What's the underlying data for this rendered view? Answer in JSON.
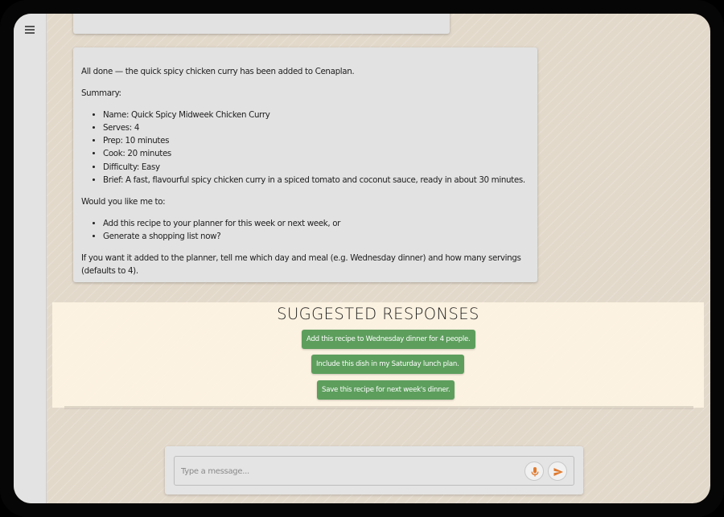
{
  "sidebar": {
    "menu_icon": "hamburger-menu-icon"
  },
  "chat": {
    "message": {
      "intro": "All done — the quick spicy chicken curry has been added to Cenaplan.",
      "summary_label": "Summary:",
      "summary_items": [
        "Name: Quick Spicy Midweek Chicken Curry",
        "Serves: 4",
        "Prep: 10 minutes",
        "Cook: 20 minutes",
        "Difficulty: Easy",
        "Brief: A fast, flavourful spicy chicken curry in a spiced tomato and coconut sauce, ready in about 30 minutes."
      ],
      "question": "Would you like me to:",
      "options": [
        "Add this recipe to your planner for this week or next week, or",
        "Generate a shopping list now?"
      ],
      "closing": "If you want it added to the planner, tell me which day and meal (e.g. Wednesday dinner) and how many servings (defaults to 4)."
    }
  },
  "suggestions": {
    "title": "SUGGESTED RESPONSES",
    "items": [
      "Add this recipe to Wednesday dinner for 4 people.",
      "Include this dish in my Saturday lunch plan.",
      "Save this recipe for next week's dinner."
    ]
  },
  "composer": {
    "placeholder": "Type a message...",
    "mic_icon": "microphone-icon",
    "send_icon": "send-icon"
  },
  "colors": {
    "chip": "#5d9e5d",
    "icon_accent": "#e07a2e",
    "background": "#e3d9cb"
  }
}
